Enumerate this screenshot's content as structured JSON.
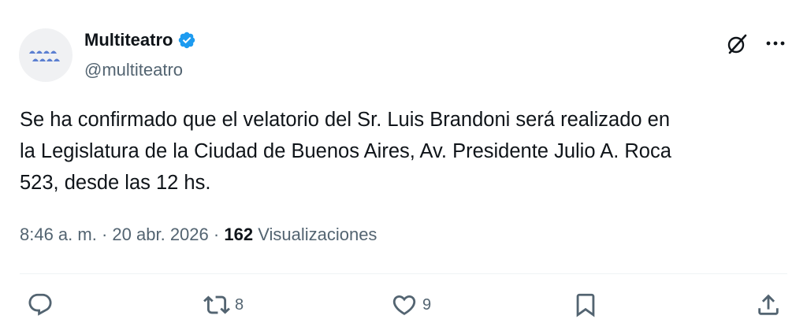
{
  "author": {
    "name": "Multiteatro",
    "handle": "@multiteatro",
    "verified": true,
    "verified_color": "#1d9bf0"
  },
  "tweet": {
    "text": "Se ha confirmado que el velatorio del Sr. Luis Brandoni será realizado en\nla Legislatura de la Ciudad de Buenos Aires, Av. Presidente Julio A. Roca\n523, desde las 12 hs.",
    "time": "8:46 a. m.",
    "date": "20 abr. 2026",
    "separator": "·",
    "views_count": "162",
    "views_label": "Visualizaciones"
  },
  "actions": {
    "reply": {
      "icon": "reply-icon"
    },
    "repost": {
      "icon": "repost-icon",
      "count": "8"
    },
    "like": {
      "icon": "heart-icon",
      "count": "9"
    },
    "bookmark": {
      "icon": "bookmark-icon"
    },
    "share": {
      "icon": "share-icon"
    }
  },
  "header_icons": {
    "grok": "grok-icon",
    "more": "more-icon"
  },
  "colors": {
    "text_primary": "#0f1419",
    "text_secondary": "#536471",
    "divider": "#eff3f4",
    "logo_blue": "#5b7fd1"
  }
}
